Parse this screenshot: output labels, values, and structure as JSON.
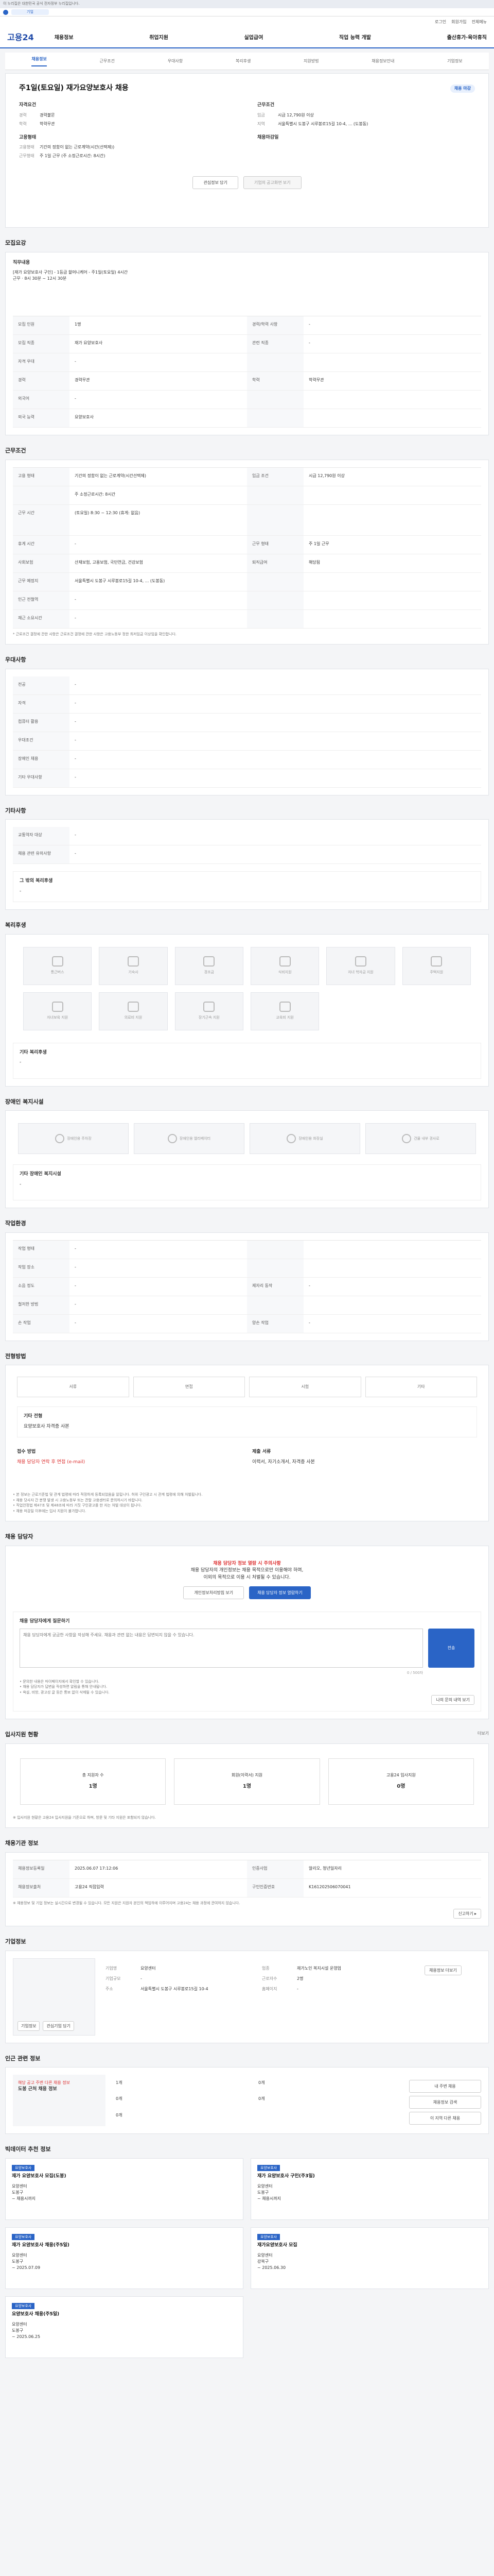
{
  "banner": {
    "text": "이 누리집은 대한민국 공식 전자정부 누리집입니다."
  },
  "gov": {
    "pill": "기업"
  },
  "util": {
    "items": [
      "로그인",
      "회원가입",
      "전체메뉴"
    ]
  },
  "gnb": {
    "logo": "고용24",
    "menu": [
      "채용정보",
      "취업지원",
      "실업급여",
      "직업 능력 개발",
      "출산휴가·육아휴직"
    ]
  },
  "tabs": {
    "items": [
      "채용정보",
      "근무조건",
      "우대사항",
      "복리후생",
      "지원방법",
      "채용정보안내",
      "기업정보"
    ]
  },
  "job": {
    "title": "주1일(토요일) 재가요양보호사 채용",
    "badge": "채용 마감",
    "left_group": "자격요건",
    "left_items": [
      {
        "k": "경력",
        "v": "경력불문"
      },
      {
        "k": "학력",
        "v": "학력무관"
      }
    ],
    "left_group2": "고용형태",
    "left_items2": [
      {
        "k": "고용형태",
        "v": "기간의 정함이 없는 근로계약(시간(선택제))"
      },
      {
        "k": "근무형태",
        "v": "주 1일 근무 (주 소정근로시간: 8시간)"
      }
    ],
    "right_group": "근무조건",
    "right_items": [
      {
        "k": "임금",
        "v": "시급 12,790원 이상"
      },
      {
        "k": "지역",
        "v": "서울특별시 도봉구 시루봉로15길 10-4, ... (도봉동)"
      }
    ],
    "right_group2": "채용마감일",
    "apply_btn": "관심정보 담기",
    "share_btn": "기업의 공고화면 보기"
  },
  "recruit": {
    "title": "모집요강",
    "duties_label": "직무내용",
    "duties": "[재가 요양보호사 구인] - 1등급 할머니케어 - 주1일(토요일) 4시간 근무 · 8시 30분 ~ 12시 30분",
    "rows": [
      [
        "모집 인원",
        "1명",
        "경력/학력 사항",
        "-"
      ],
      [
        "모집 직종",
        "재가 요양보호사",
        "관련 직종",
        "-"
      ],
      [
        "자격 우대",
        "-",
        "",
        ""
      ],
      [
        "경력",
        "경력무관",
        "학력",
        "학력무관"
      ],
      [
        "외국어",
        "-",
        "",
        ""
      ]
    ],
    "lang_label": "외국 능력",
    "lang_val": "요양보호사"
  },
  "cond": {
    "title": "근무조건",
    "rows": [
      [
        "고용 형태",
        "기간의 정함이 없는 근로계약(시간선택제)",
        "임금 조건",
        "시급 12,790원 이상"
      ],
      [
        "",
        "주 소정근로시간: 8시간",
        "",
        ""
      ],
      [
        "근무 시간",
        "(토요일) 8:30 ~ 12:30 (휴게: 없음)",
        "",
        ""
      ],
      [
        "휴게 시간",
        "-",
        "근무 형태",
        "주 1일 근무"
      ],
      [
        "사회보험",
        "산재보험, 고용보험, 국민연금, 건강보험",
        "퇴직급여",
        "해당됨"
      ],
      [
        "근무 예정지",
        "서울특별시 도봉구 시루봉로15길 10-4, ... (도봉동)",
        "",
        ""
      ],
      [
        "인근 전철역",
        "-",
        "",
        ""
      ],
      [
        "재근 소요시간",
        "-",
        "",
        ""
      ]
    ],
    "note": "* 근로조건 결정에 관한 사항은 근로조건 결정에 관한 사항은 고용노동부 정한 최저임금 이상임을 확인합니다."
  },
  "pref": {
    "title": "우대사항",
    "rows": [
      [
        "전공",
        "-"
      ],
      [
        "자격",
        "-"
      ],
      [
        "컴퓨터 활용",
        "-"
      ],
      [
        "우대조건",
        "-"
      ],
      [
        "장애인 채용",
        "-"
      ],
      [
        "기타 우대사항",
        "-"
      ]
    ]
  },
  "other": {
    "title": "기타사항",
    "rows": [
      [
        "교통약자 대상",
        "-"
      ],
      [
        "채용 관련 유의사항",
        "-"
      ]
    ],
    "extra_label": "그 밖의 복리후생",
    "extra_val": "-"
  },
  "welfare": {
    "title": "복리후생",
    "items": [
      "통근버스",
      "기숙사",
      "경조금",
      "식비지원",
      "자녀 학자금 지원",
      "주택지원",
      "자녀보육 지원",
      "의료비 지원",
      "장기근속 지원",
      "교육비 지원"
    ],
    "other_label": "기타 복리후생",
    "other_val": "-"
  },
  "disab": {
    "title": "장애인 복지시설",
    "items": [
      "장애인용 주차장",
      "장애인용 엘리베이터",
      "장애인용 화장실",
      "건물 내부 경사로"
    ],
    "other_label": "기타 장애인 복지시설",
    "other_val": "-"
  },
  "work_env": {
    "title": "작업환경",
    "rows": [
      [
        "작업 형태",
        "-",
        "",
        ""
      ],
      [
        "작업 장소",
        "-",
        "",
        ""
      ],
      [
        "소음 정도",
        "-",
        "제자리 동작",
        "-"
      ],
      [
        "철저한 방법",
        "-",
        "",
        ""
      ],
      [
        "손 작업",
        "-",
        "양손 작업",
        "-"
      ],
      [
        "장애물",
        "-",
        "",
        ""
      ],
      [
        "장기 작업",
        "-",
        "",
        ""
      ]
    ]
  },
  "apply": {
    "title": "전형방법",
    "steps": [
      "서류",
      "면접",
      "시험",
      "기타"
    ],
    "doc_label": "기타 전형",
    "doc_val": "요양보호사 자격증 사본",
    "method_label": "접수 방법",
    "method_val": "채용 담당자 연락 후 면접 (e-mail)",
    "docs_label": "제출 서류",
    "docs_val": "이력서, 자기소개서, 자격증 사본",
    "notes": [
      "• 본 정보는 근로기준법 및 관계 법령에 따라 적정하게 등록되었음을 알립니다. 허위 구인광고 시 관계 법령에 의해 처벌됩니다.",
      "• 채용 당사자 간 분쟁 발생 시 고용노동부 또는 관할 고용센터로 문의하시기 바랍니다.",
      "• 직업안정법 제47조 및 제48조에 따라 거짓 구인광고를 한 자는 처벌 대상이 됩니다.",
      "• 채용 마감일 이후에는 입사 지원이 불가합니다."
    ]
  },
  "contact": {
    "title": "채용 담당자",
    "warn": "채용 담당자 정보 열람 시 주의사항",
    "msg1": "채용 담당자의 개인정보는 채용 목적으로만 이용해야 하며,",
    "msg2": "이외의 목적으로 이용 시 처벌될 수 있습니다.",
    "btn1": "개인정보처리방침 보기",
    "btn2": "채용 담당자 정보 열람하기",
    "inq_label": "채용 담당자에게 질문하기",
    "inq_placeholder": "채용 담당자에게 궁금한 사항을 작성해 주세요. 채용과 관련 없는 내용은 답변되지 않을 수 있습니다.",
    "inq_btn": "전송",
    "counter": "0 / 500자",
    "inq_notes": [
      "• 문의한 내용은 마이페이지에서 확인할 수 있습니다.",
      "• 채용 담당자가 답변을 작성하면 알림을 통해 안내됩니다.",
      "• 욕설, 비방, 광고성 글 등은 통보 없이 삭제될 수 있습니다."
    ],
    "inq_link": "나의 문의 내역 보기"
  },
  "stats": {
    "title": "입사지원 현황",
    "more": "더보기",
    "items": [
      {
        "k": "총 지원자 수",
        "v": "1명"
      },
      {
        "k": "회원(이력서) 지원",
        "v": "1명"
      },
      {
        "k": "고용24 입사지원",
        "v": "0명"
      }
    ],
    "note": "※ 입사지원 현황은 고용24 입사지원을 기준으로 하며, 방문 및 기타 지원은 포함되지 않습니다."
  },
  "meta": {
    "title": "채용기관 정보",
    "rows": [
      [
        "채용정보등록일",
        "2025.06.07 17:12:06",
        "인증사업",
        "알리오, 청년일자리"
      ],
      [
        "채용정보출처",
        "고용24 직접입력",
        "구인인증번호",
        "K161202506070041"
      ],
      [
        "",
        ""
      ]
    ],
    "note": "※ 채용정보 및 기업 정보는 실시간으로 변경될 수 있습니다. 모든 지원은 지원자 본인의 책임하에 이루어지며 고용24는 채용 과정에 관여하지 않습니다.",
    "edit_btn": "신고하기 ▸"
  },
  "company": {
    "title": "기업정보",
    "name_k": "기업명",
    "name_v": "요양센터",
    "type_k": "업종",
    "type_v": "재가노인 복지시설 운영업",
    "size_k": "기업규모",
    "size_v": "-",
    "emp_k": "근로자수",
    "emp_v": "2명",
    "addr_k": "주소",
    "addr_v": "서울특별시 도봉구 시루봉로15길 10-4",
    "home_k": "홈페이지",
    "home_v": "-",
    "btn1": "기업정보",
    "btn2": "관심기업 담기",
    "more": "채용정보 더보기"
  },
  "nearby": {
    "title": "인근 관련 정보",
    "subtitle": "해당 공고 주변 다른 채용 정보",
    "list_label": "도봉 근처 채용 정보",
    "items": [
      "1개",
      "0개",
      "0개",
      "0개",
      "0개"
    ],
    "btns": [
      "내 주변 채용",
      "채용정보 검색",
      "이 지역 다른 채용"
    ]
  },
  "recommend": {
    "title": "빅데이터 추천 정보",
    "cards": [
      {
        "tag": "요양보호사",
        "name": "재가 요양보호사 모집(도봉)",
        "co": "요양센터",
        "loc": "도봉구",
        "date": "~ 채용시까지"
      },
      {
        "tag": "요양보호사",
        "name": "재가 요양보호사 구인(주3일)",
        "co": "요양센터",
        "loc": "도봉구",
        "date": "~ 채용시까지"
      },
      {
        "tag": "요양보호사",
        "name": "재가 요양보호사 채용(주5일)",
        "co": "요양센터",
        "loc": "도봉구",
        "date": "~ 2025.07.09"
      },
      {
        "tag": "요양보호사",
        "name": "재가요양보호사 모집",
        "co": "요양센터",
        "loc": "강북구",
        "date": "~ 2025.06.30"
      },
      {
        "tag": "요양보호사",
        "name": "요양보호사 채용(주5일)",
        "co": "요양센터",
        "loc": "도봉구",
        "date": "~ 2025.06.25"
      }
    ]
  }
}
